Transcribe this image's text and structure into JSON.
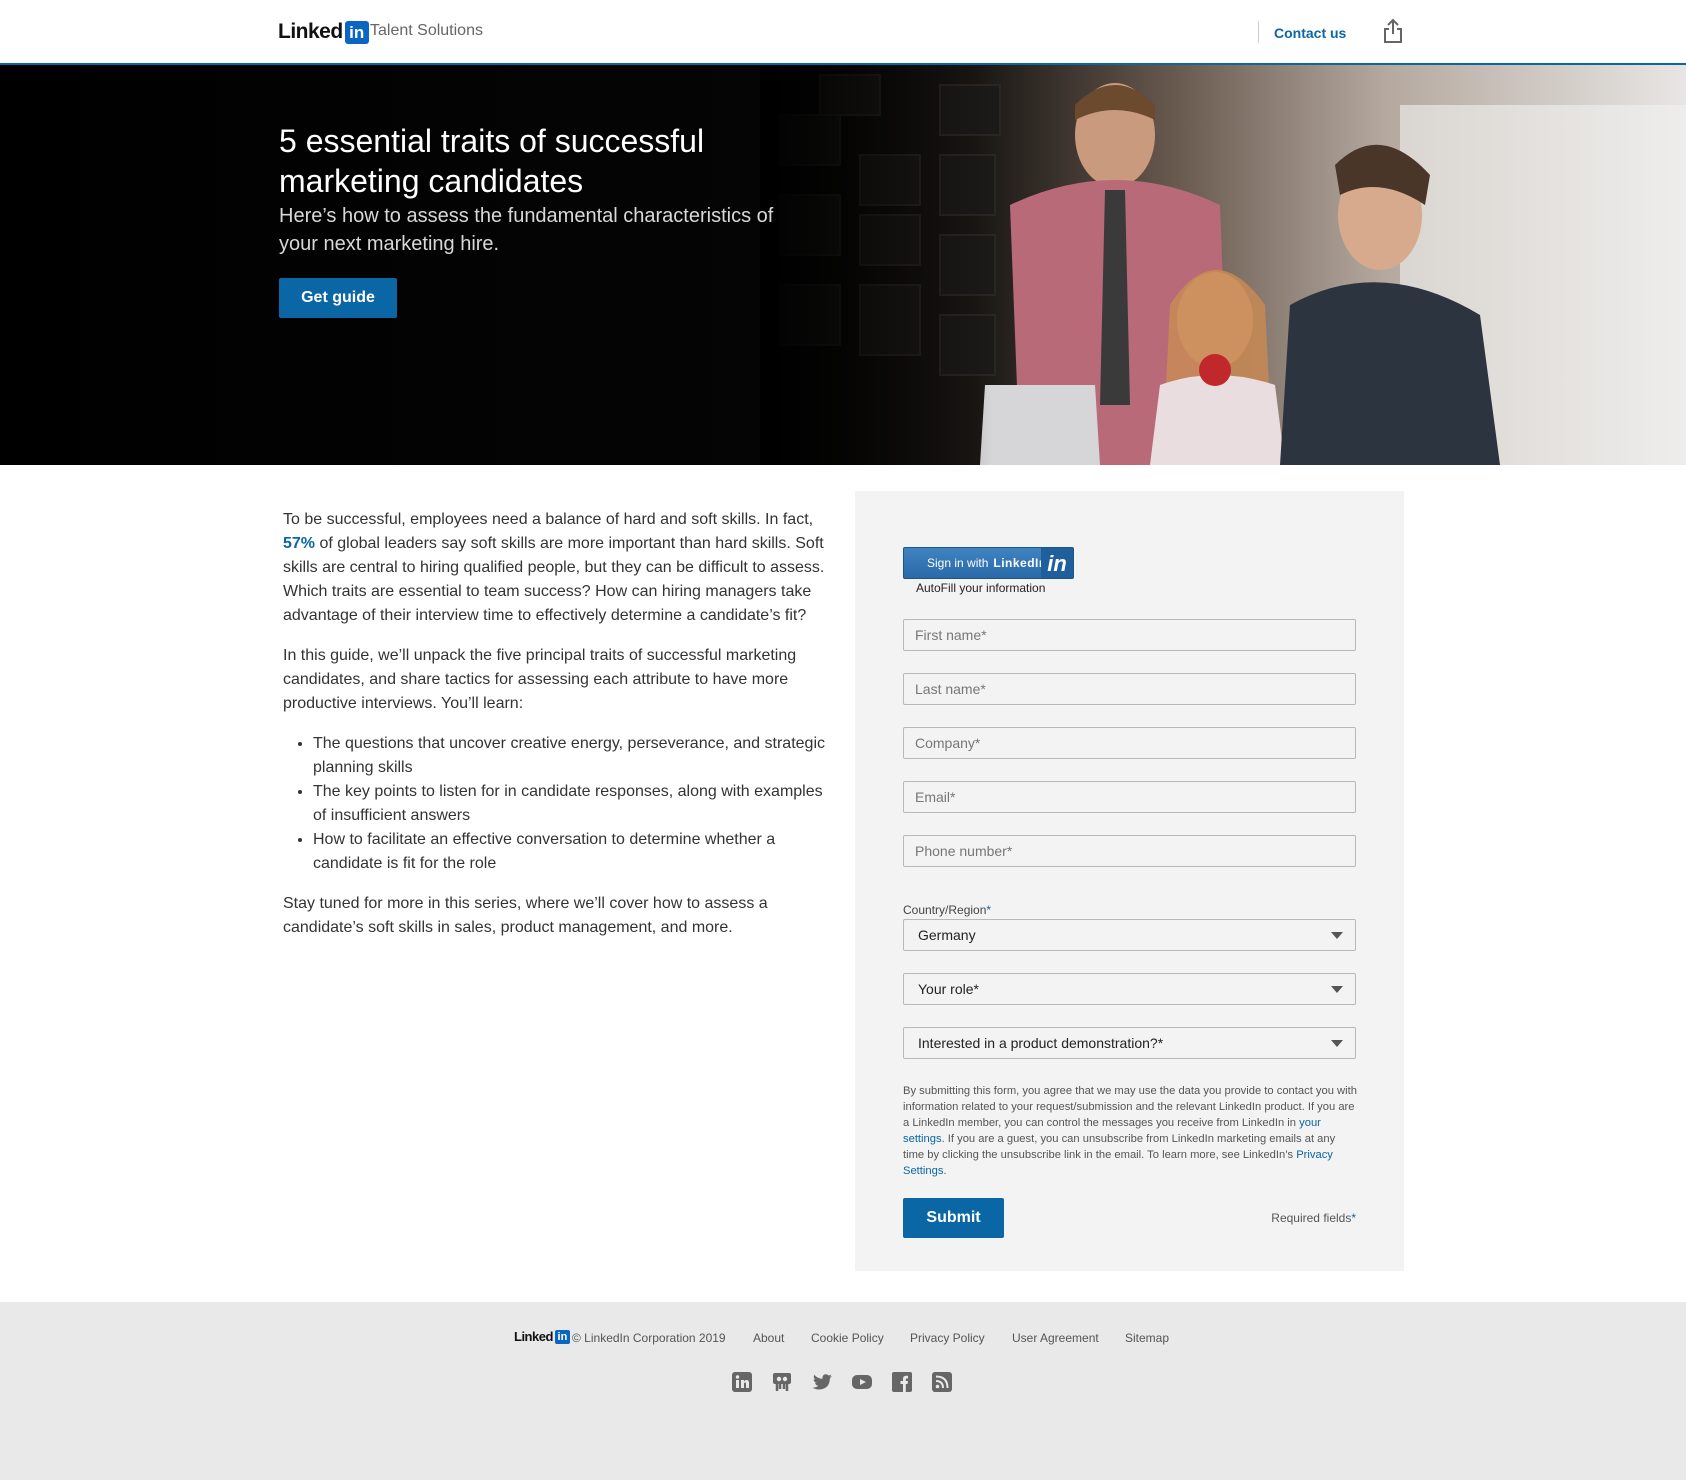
{
  "header": {
    "logo_text": "Linked",
    "logo_in": "in",
    "product": "Talent Solutions",
    "contact": "Contact us",
    "share_icon": "share-icon"
  },
  "hero": {
    "title": "5 essential traits of successful marketing candidates",
    "subtitle": "Here’s how to assess the fundamental characteristics of your next marketing hire.",
    "cta": "Get guide"
  },
  "content": {
    "p1_before": "To be successful, employees need a balance of hard and soft skills. In fact, ",
    "p1_link": "57%",
    "p1_after": " of global leaders say soft skills are more important than hard skills. Soft skills are central to hiring qualified people, but they can be difficult to assess. Which traits are essential to team success? How can hiring managers take advantage of their interview time to effectively determine a candidate’s fit?",
    "p2": "In this guide, we’ll unpack the five principal traits of successful marketing candidates, and share tactics for assessing each attribute to have more productive interviews. You’ll learn:",
    "bullets": [
      "The questions that uncover creative energy, perseverance, and strategic planning skills",
      "The key points to listen for in candidate responses, along with examples of insufficient answers",
      "How to facilitate an effective conversation to determine whether a candidate is fit for the role"
    ],
    "p3": "Stay tuned for more in this series, where we’ll cover how to assess a candidate’s soft skills in sales, product management, and more."
  },
  "form": {
    "signin_prefix": "Sign in with",
    "signin_brand": "LinkedIn",
    "signin_in": "in",
    "autofill": "AutoFill your information",
    "first_name": "First name*",
    "last_name": "Last name*",
    "company": "Company*",
    "email": "Email*",
    "phone": "Phone number*",
    "country_label": "Country/Region",
    "country_req": "*",
    "country_value": "Germany",
    "role": "Your role*",
    "demo": "Interested in a product demonstration?*",
    "legal_1": "By submitting this form, you agree that we may use the data you provide to contact you with information related to your request/submission and the relevant LinkedIn product. If you are a LinkedIn member, you can control the messages you receive from LinkedIn in ",
    "legal_link1": "your settings",
    "legal_2": ". If you are a guest, you can unsubscribe from LinkedIn marketing emails at any time by clicking the unsubscribe link in the email. To learn more, see LinkedIn’s ",
    "legal_link2": "Privacy Settings",
    "legal_3": ".",
    "submit": "Submit",
    "required": "Required fields",
    "required_star": "*"
  },
  "footer": {
    "logo_text": "Linked",
    "logo_in": "in",
    "copyright": "© LinkedIn Corporation 2019",
    "links": [
      "About",
      "Cookie Policy",
      "Privacy Policy",
      "User Agreement",
      "Sitemap"
    ],
    "social_icons": [
      "linkedin-icon",
      "slideshare-icon",
      "twitter-icon",
      "youtube-icon",
      "facebook-icon",
      "rss-icon"
    ]
  },
  "colors": {
    "brand_blue": "#0a66a5",
    "footer_bg": "#e9e9e9",
    "form_bg": "#f3f3f3"
  }
}
